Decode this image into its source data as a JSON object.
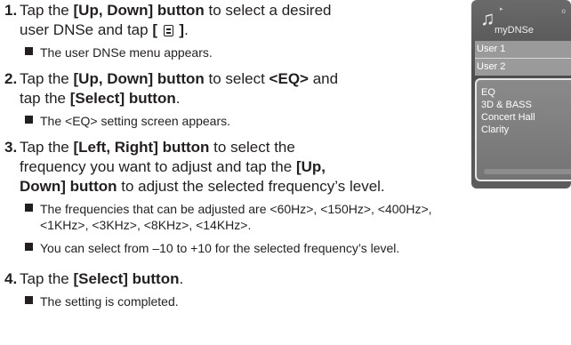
{
  "steps": [
    {
      "num": "1.",
      "line1": {
        "a": "Tap the ",
        "b": "[Up, Down] button",
        "c": " to select a desired"
      },
      "line2": {
        "a": "user DNSe and tap ",
        "b1": "[ ",
        "b2": " ]",
        "c": "."
      },
      "bullets": [
        "The user DNSe menu appears."
      ]
    },
    {
      "num": "2.",
      "line1": {
        "a": "Tap the ",
        "b": "[Up, Down] button",
        "c": " to select ",
        "d": "<EQ>",
        "e": " and"
      },
      "line2": {
        "a": "tap the ",
        "b": "[Select] button",
        "c": "."
      },
      "bullets": [
        "The <EQ> setting screen appears."
      ]
    },
    {
      "num": "3.",
      "line1": {
        "a": "Tap the ",
        "b": "[Left, Right] button",
        "c": " to select the"
      },
      "line2": {
        "a": "frequency you want to adjust and tap the ",
        "b": "[Up,"
      },
      "line3": {
        "a": "Down] button",
        "b": " to adjust the selected frequency’s level."
      },
      "bullets": [
        "The frequencies that can be adjusted are <60Hz>, <150Hz>, <400Hz>,",
        "<1KHz>, <3KHz>, <8KHz>, <14KHz>.",
        "You can select from –10 to +10 for the selected frequency’s level."
      ]
    },
    {
      "num": "4.",
      "line1": {
        "a": "Tap the ",
        "b": "[Select] button",
        "c": "."
      },
      "bullets": [
        "The setting is completed."
      ]
    }
  ],
  "device": {
    "title": "myDNSe",
    "menu_items": [
      "User 1",
      "User 2"
    ],
    "popup_items": [
      "EQ",
      "3D & BASS",
      "Concert Hall",
      "Clarity"
    ],
    "icons": {
      "music": "music-note-icon",
      "menu": "menu-icon"
    }
  }
}
